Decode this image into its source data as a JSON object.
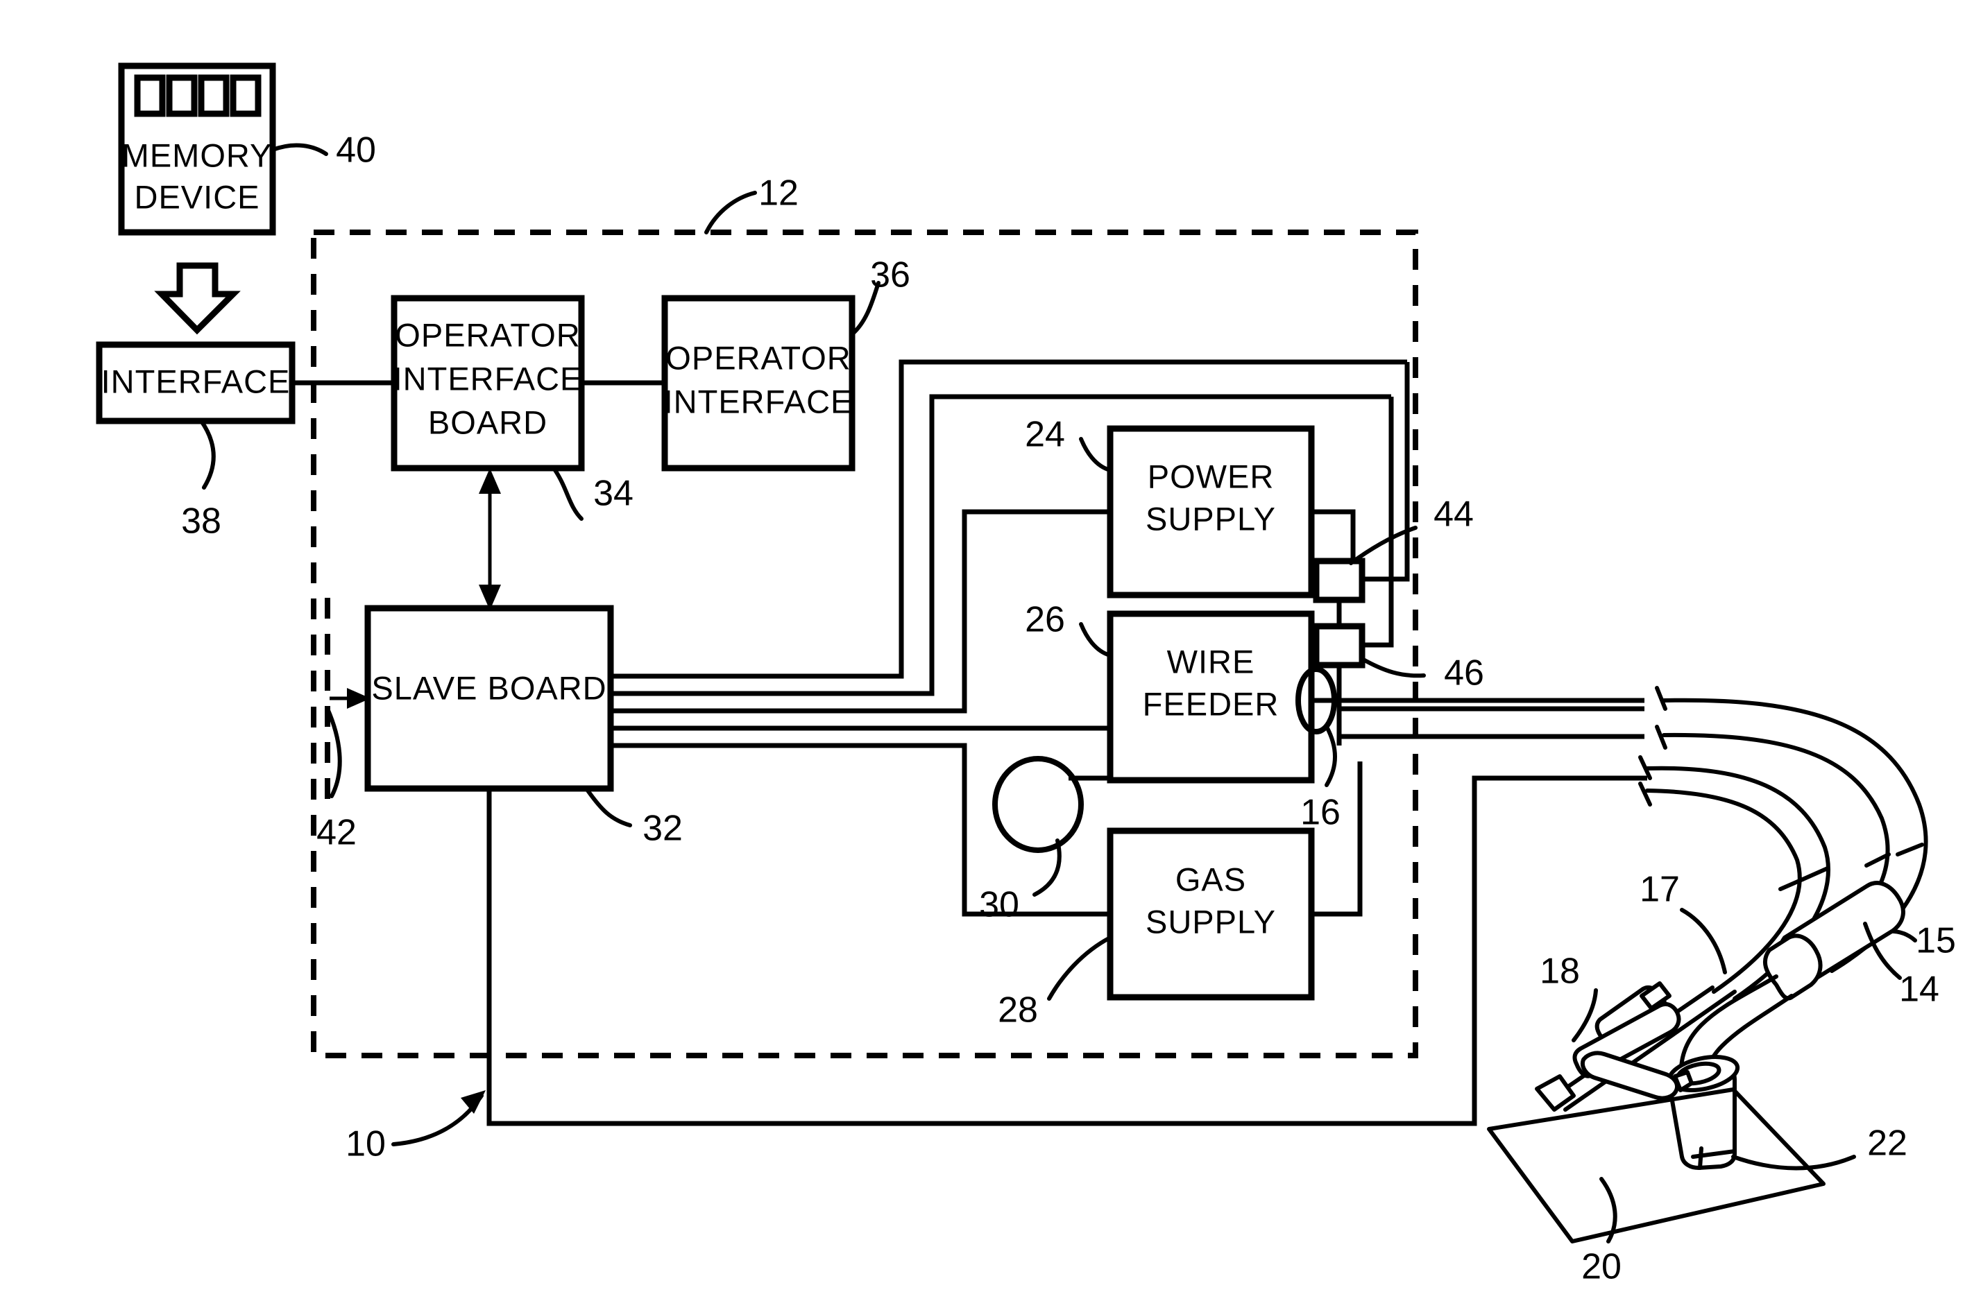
{
  "figure": {
    "type": "patent-block-diagram",
    "title": "Welding system block diagram"
  },
  "blocks": {
    "memory_device": {
      "label_line1": "MEMORY",
      "label_line2": "DEVICE",
      "ref": "40"
    },
    "interface": {
      "label": "INTERFACE",
      "ref": "38"
    },
    "operator_interface_board": {
      "label_line1": "OPERATOR",
      "label_line2": "INTERFACE",
      "label_line3": "BOARD",
      "ref": "34"
    },
    "operator_interface": {
      "label_line1": "OPERATOR",
      "label_line2": "INTERFACE",
      "ref": "36"
    },
    "slave_board": {
      "label": "SLAVE  BOARD",
      "ref": "32"
    },
    "power_supply": {
      "label_line1": "POWER",
      "label_line2": "SUPPLY",
      "ref": "24"
    },
    "wire_feeder": {
      "label_line1": "WIRE",
      "label_line2": "FEEDER",
      "ref": "26"
    },
    "gas_supply": {
      "label_line1": "GAS",
      "label_line2": "SUPPLY",
      "ref": "28"
    }
  },
  "refs": {
    "system": "10",
    "enclosure": "12",
    "gun_cable": "14",
    "weld_cable": "15",
    "wire_spool": "16",
    "work_cable": "17",
    "work_clamp": "18",
    "workpiece": "20",
    "weld_point": "22",
    "power_supply": "24",
    "wire_feeder": "26",
    "gas_supply": "28",
    "gas_cylinder": "30",
    "slave_board": "32",
    "operator_interface_board": "34",
    "operator_interface": "36",
    "interface": "38",
    "memory_device": "40",
    "control_circuitry": "42",
    "connector_upper": "44",
    "connector_lower": "46"
  },
  "icons": {
    "memory_contacts": "memory-contacts-icon",
    "download_arrow": "download-arrow-icon",
    "bidirectional_arrow": "bidirectional-arrow-icon",
    "gas_cylinder": "gas-cylinder-icon",
    "wire_spool": "wire-spool-icon",
    "connector_block": "connector-block-icon",
    "welding_gun": "welding-gun-icon",
    "work_clamp": "work-clamp-icon",
    "workpiece_plate": "workpiece-plate-icon"
  },
  "colors": {
    "ink": "#000000",
    "paper": "#ffffff"
  }
}
